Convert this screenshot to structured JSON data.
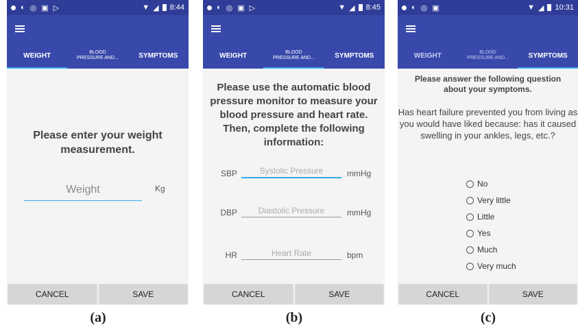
{
  "status": {
    "a": {
      "time": "8:44"
    },
    "b": {
      "time": "8:45"
    },
    "c": {
      "time": "10:31"
    }
  },
  "tabs": {
    "weight": "WEIGHT",
    "blood": "BLOOD\nPRESSURE AND...",
    "symptoms": "SYMPTOMS"
  },
  "buttons": {
    "cancel": "CANCEL",
    "save": "SAVE"
  },
  "screen_a": {
    "prompt": "Please enter your weight measurement.",
    "weight_placeholder": "Weight",
    "unit": "Kg"
  },
  "screen_b": {
    "prompt": "Please use the automatic blood pressure monitor to measure your blood pressure and heart rate. Then, complete the following information:",
    "sbp_label": "SBP",
    "sbp_placeholder": "Systolic Pressure",
    "sbp_unit": "mmHg",
    "dbp_label": "DBP",
    "dbp_placeholder": "Diastolic Pressure",
    "dbp_unit": "mmHg",
    "hr_label": "HR",
    "hr_placeholder": "Heart Rate",
    "hr_unit": "bpm"
  },
  "screen_c": {
    "intro": "Please answer the following question about your symptoms.",
    "question": "Has heart failure prevented you from living as you would have liked because: has it caused swelling in your ankles, legs, etc.?",
    "options": [
      "No",
      "Very little",
      "Little",
      "Yes",
      "Much",
      "Very much"
    ]
  },
  "captions": {
    "a": "(a)",
    "b": "(b)",
    "c": "(c)"
  },
  "colors": {
    "status": "#2f3d98",
    "appbar": "#3949ab",
    "accent": "#35a9e4"
  }
}
